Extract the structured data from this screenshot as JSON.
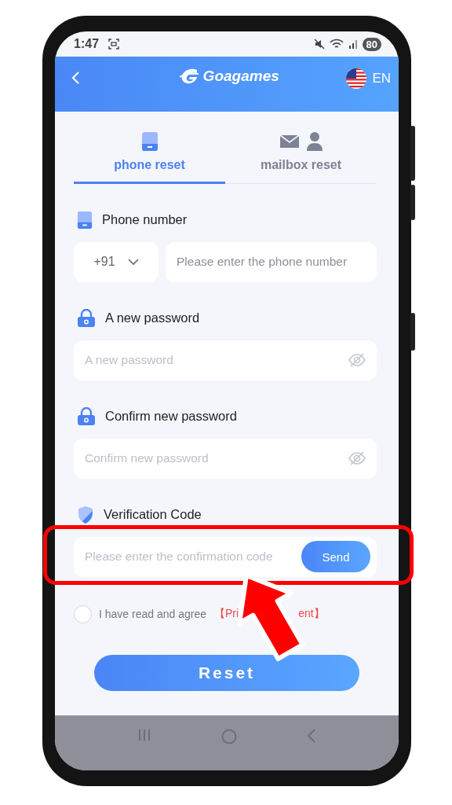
{
  "status_bar": {
    "time": "1:47",
    "battery": "80"
  },
  "header": {
    "title": "Goagames",
    "language": "EN"
  },
  "tabs": [
    {
      "label": "phone reset",
      "kind": "phone",
      "selected": true
    },
    {
      "label": "mailbox reset",
      "kind": "mail",
      "selected": false
    }
  ],
  "sections": [
    {
      "kind": "phone",
      "label": "Phone number",
      "country_code": "+91",
      "placeholder": "Please enter the phone number"
    },
    {
      "kind": "password",
      "label": "A new password",
      "placeholder": "A new password"
    },
    {
      "kind": "password",
      "label": "Confirm new password",
      "placeholder": "Confirm new password"
    },
    {
      "kind": "code",
      "label": "Verification Code",
      "placeholder": "Please enter the confirmation code",
      "button": "Send"
    }
  ],
  "agreement": {
    "checked": false,
    "text": "I have read and agree",
    "link_start": "【Pri",
    "link_end": "ent】"
  },
  "reset_button": "Reset"
}
